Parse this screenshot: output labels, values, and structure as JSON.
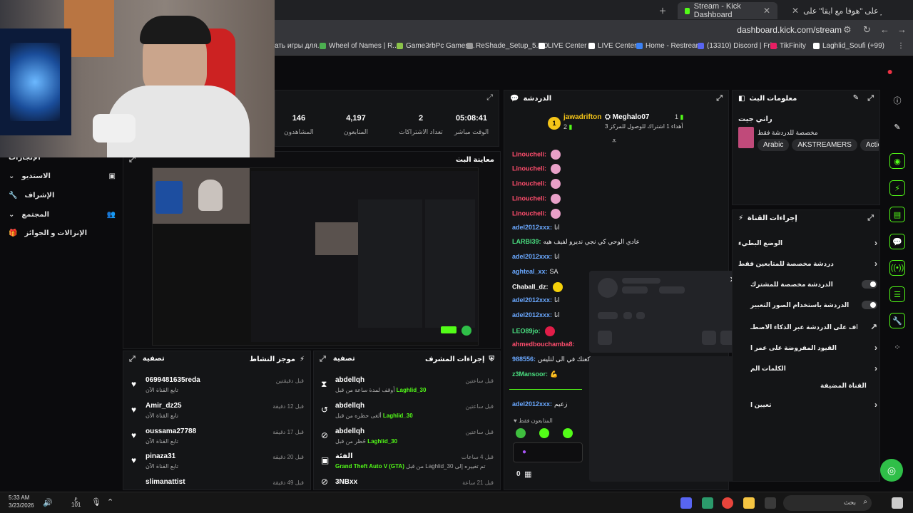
{
  "browser": {
    "tabs": [
      {
        "label": "Stream - Kick Dashboard",
        "active": true
      },
      {
        "label": "اعتذر على \"هوفا مع ايقا\" على Tok",
        "active": false
      }
    ],
    "url": "dashboard.kick.com/stream",
    "bookmarks": [
      {
        "label": "ать игры для...",
        "color": "#e65"
      },
      {
        "label": "Wheel of Names | R...",
        "color": "#4caf50"
      },
      {
        "label": "Game3rbPc Games...",
        "color": "#8bc34a"
      },
      {
        "label": "ReShade_Setup_5.8.0",
        "color": "#999"
      },
      {
        "label": "LIVE Center",
        "color": "#fff"
      },
      {
        "label": "LIVE Center",
        "color": "#fff"
      },
      {
        "label": "Home - Restream",
        "color": "#3b82f6"
      },
      {
        "label": "(13310) Discord | Fri...",
        "color": "#5865f2"
      },
      {
        "label": "TikFinity",
        "color": "#e91e63"
      },
      {
        "label": "Laghlid_Soufi (+99)",
        "color": "#fff"
      }
    ]
  },
  "stats": {
    "viewers": {
      "value": "146",
      "label": "المشاهدون"
    },
    "followers": {
      "value": "4,197",
      "label": "المتابعون"
    },
    "subs": {
      "value": "2",
      "label": "تعداد الاشتراكات"
    },
    "uptime": {
      "value": "05:08:41",
      "label": "الوقت مباشر"
    }
  },
  "sidebar": {
    "items": [
      {
        "label": "الإنجازات"
      },
      {
        "label": "الاستديو"
      },
      {
        "label": "الإشراف"
      },
      {
        "label": "المجتمع"
      },
      {
        "label": "الإنزالات و الجوائز"
      }
    ]
  },
  "preview": {
    "title": "معاينة البث"
  },
  "activity": {
    "title": "موجز النشاط",
    "filter": "تصفية",
    "rows": [
      {
        "name": "0699481635reda",
        "sub": "تابع القناة الآن",
        "time": "قبل دقيقتين"
      },
      {
        "name": "Amir_dz25",
        "sub": "تابع القناة الآن",
        "time": "قبل 12 دقيقة"
      },
      {
        "name": "oussama27788",
        "sub": "تابع القناة الآن",
        "time": "قبل 17 دقيقة"
      },
      {
        "name": "pinaza31",
        "sub": "تابع القناة الآن",
        "time": "قبل 20 دقيقة"
      },
      {
        "name": "slimanattist",
        "sub": "",
        "time": "قبل 49 دقيقة"
      }
    ]
  },
  "modactions": {
    "title": "إجراءات المشرف",
    "filter": "تصفية",
    "rows": [
      {
        "name": "abdellqh",
        "pre": "أوقف لمدة ساعة من قبل",
        "mod": "Laghlid_30",
        "time": "قبل ساعتين",
        "icon": "⧗"
      },
      {
        "name": "abdellqh",
        "pre": "ألغى حظره من قبل",
        "mod": "Laghlid_30",
        "time": "قبل ساعتين",
        "icon": "↺"
      },
      {
        "name": "abdellqh",
        "pre": "حُظر من قبل",
        "mod": "Laghlid_30",
        "time": "قبل ساعتين",
        "icon": "⊘"
      },
      {
        "name": "الفئة",
        "pre": "تم تغييره إلى",
        "mod": "Grand Theft Auto V (GTA)",
        "post": "من قبل Laghlid_30",
        "time": "قبل 4 ساعات",
        "icon": "▣"
      },
      {
        "name": "3NBxx",
        "pre": "",
        "mod": "",
        "time": "قبل 21 ساعة",
        "icon": "⊘"
      }
    ]
  },
  "chat": {
    "title": "الدردشة",
    "top": {
      "rank1": {
        "name": "jawadrifton",
        "count": "2"
      },
      "rank2": {
        "name": "Meghalo07",
        "count": "1",
        "sub": "أهداء 1 اشتراك للوصول للمركز 3"
      }
    },
    "messages": [
      {
        "user": "Linoucheli:",
        "text": "",
        "color": "#ff4d6d",
        "emote": true
      },
      {
        "user": "Linoucheli:",
        "text": "",
        "color": "#ff4d6d",
        "emote": true
      },
      {
        "user": "Linoucheli:",
        "text": "",
        "color": "#ff4d6d",
        "emote": true
      },
      {
        "user": "Linoucheli:",
        "text": "",
        "color": "#ff4d6d",
        "emote": true
      },
      {
        "user": "Linoucheli:",
        "text": "",
        "color": "#ff4d6d",
        "emote": true
      },
      {
        "user": "adel2012xxx:",
        "text": "انا",
        "color": "#6aa8ff"
      },
      {
        "user": "LARBI39:",
        "text": "عادي الوحي كي نجي نديرو لفيف هيه",
        "color": "#4ade80"
      },
      {
        "user": "adel2012xxx:",
        "text": "انا",
        "color": "#6aa8ff"
      },
      {
        "user": "aghteal_xx:",
        "text": "SA",
        "color": "#6aa8ff"
      },
      {
        "user": "Chaball_dz:",
        "text": "",
        "color": "#ffffff",
        "emote": true
      },
      {
        "user": "adel2012xxx:",
        "text": "انا",
        "color": "#6aa8ff"
      },
      {
        "user": "adel2012xxx:",
        "text": "انا",
        "color": "#6aa8ff"
      },
      {
        "user": "LEO89jo:",
        "text": "",
        "color": "#4ade80",
        "emote": true
      },
      {
        "user": "ahmedbouchamba8:",
        "text": "",
        "color": "#ff4d6d"
      },
      {
        "user": "988556:",
        "text": "كعتك في الى لتليس",
        "color": "#6aa8ff"
      },
      {
        "user": "z3Mansoor:",
        "text": "💪",
        "color": "#4ade80"
      },
      {
        "user": "adel2012xxx:",
        "text": "زعيم",
        "color": "#6aa8ff"
      }
    ],
    "followers_only": "المتابعون فقط",
    "points": "0"
  },
  "streaminfo": {
    "title": "معلومات البث",
    "stream_title": "راني جيت",
    "category": "مخصصة للدردشة فقط",
    "tags": [
      "Arabic",
      "AKSTREAMERS",
      "Action"
    ]
  },
  "channelactions": {
    "title": "إجراءات القناة",
    "rows": [
      {
        "label": "الوضع البطيء",
        "control": "chev"
      },
      {
        "label": "دردشة مخصصة للمتابعين فقط",
        "control": "chev"
      },
      {
        "label": "الدردشة مخصصة للمشترك",
        "control": "toggle"
      },
      {
        "label": "الدردشة باستخدام الصور التعبير",
        "control": "toggle"
      },
      {
        "label": "الإشراف على الدردشة عبر الذكاء الاصطـ",
        "control": "link"
      },
      {
        "label": "القيود المفروضة على عمر ا",
        "control": "chev"
      },
      {
        "label": "الكلمات الم",
        "control": "chev"
      },
      {
        "label": "القناة المضيفة",
        "control": "none"
      },
      {
        "label": "تعيين ا",
        "control": "chev"
      }
    ]
  },
  "taskbar": {
    "time": "5:33 AM",
    "date": "3/23/2026",
    "search": "بحث",
    "lang": "ع",
    "num": "101"
  }
}
